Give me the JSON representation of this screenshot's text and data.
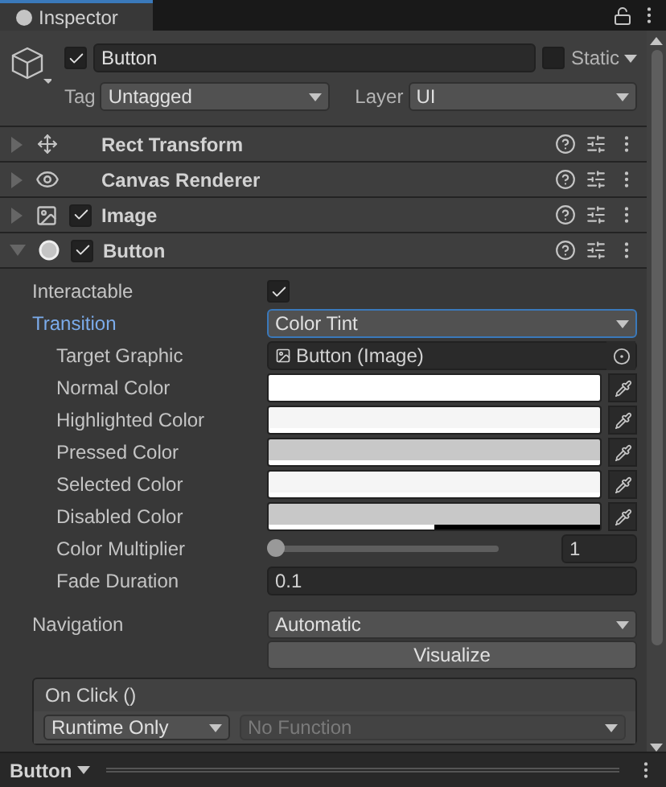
{
  "tab": {
    "label": "Inspector",
    "selected": true
  },
  "header": {
    "active": true,
    "name": "Button",
    "static": false,
    "static_label": "Static",
    "tag_label": "Tag",
    "tag": "Untagged",
    "layer_label": "Layer",
    "layer": "UI"
  },
  "components": [
    {
      "name": "Rect Transform",
      "kind": "arrows",
      "expanded": false
    },
    {
      "name": "Canvas Renderer",
      "kind": "eye",
      "expanded": false
    },
    {
      "name": "Image",
      "kind": "image",
      "expanded": false,
      "enabled": true
    },
    {
      "name": "Button",
      "kind": "button",
      "expanded": true,
      "enabled": true
    }
  ],
  "properties": [
    {
      "kind": "checkbox",
      "label": "Interactable",
      "checked": true
    },
    {
      "kind": "dropdown",
      "label": "Transition",
      "value": "Color Tint",
      "focused": true,
      "children": [
        {
          "kind": "object",
          "label": "Target Graphic",
          "value": "Button (Image)"
        },
        {
          "kind": "color",
          "label": "Normal Color",
          "color": "#ffffff",
          "level": 1
        },
        {
          "kind": "color",
          "label": "Highlighted Color",
          "color": "#f5f5f5",
          "level": 1
        },
        {
          "kind": "color",
          "label": "Pressed Color",
          "color": "#c8c8c8",
          "level": 1
        },
        {
          "kind": "color",
          "label": "Selected Color",
          "color": "#f5f5f5",
          "level": 1
        },
        {
          "kind": "color",
          "label": "Disabled Color",
          "color": "#c8c8c8",
          "level": 0.5
        },
        {
          "kind": "slider",
          "label": "Color Multiplier",
          "level": 0,
          "value": "1"
        },
        {
          "kind": "number",
          "label": "Fade Duration",
          "value": "0.1"
        }
      ]
    }
  ],
  "navigation": {
    "label": "Navigation",
    "value": "Automatic"
  },
  "visualize_button": "Visualize",
  "on_click": {
    "title": "On Click ()",
    "runtime": "Runtime Only",
    "function": "No Function"
  },
  "footer": {
    "label": "Button"
  }
}
